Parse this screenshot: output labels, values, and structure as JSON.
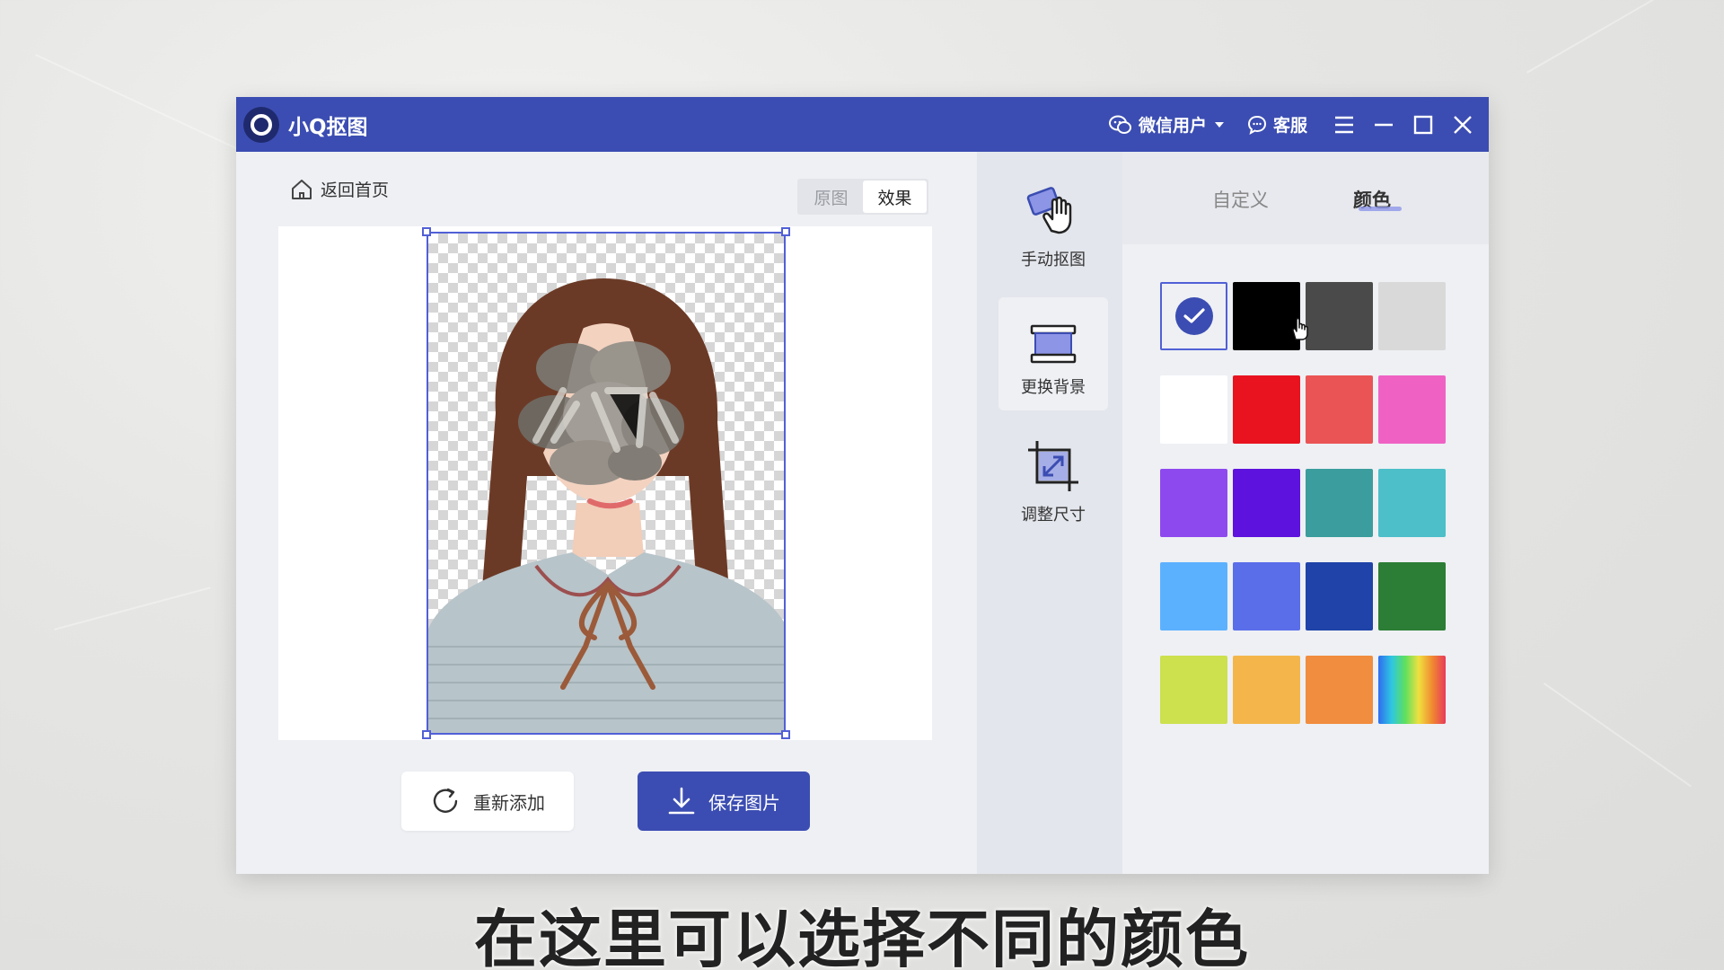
{
  "app": {
    "title": "小Q抠图"
  },
  "titlebar": {
    "user_label": "微信用户",
    "support_label": "客服"
  },
  "work": {
    "back_label": "返回首页",
    "view_toggle": {
      "original": "原图",
      "result": "效果"
    },
    "readd_label": "重新添加",
    "save_label": "保存图片"
  },
  "tools": [
    {
      "label": "手动抠图"
    },
    {
      "label": "更换背景"
    },
    {
      "label": "调整尺寸"
    }
  ],
  "panel": {
    "tabs": {
      "custom": "自定义",
      "color": "颜色"
    },
    "swatches": [
      "#eef0f4",
      "#000000",
      "#4a4a4a",
      "#d9d9d9",
      "#ffffff",
      "#e8131f",
      "#ea5454",
      "#ef62c4",
      "#8d49ee",
      "#5d12dd",
      "#3b9d9d",
      "#4cbfc9",
      "#5cb1ff",
      "#5a6ee9",
      "#1f43a8",
      "#2c7d35",
      "#cde04e",
      "#f4b64a",
      "#f18d3e",
      "rainbow"
    ],
    "selected_index": 0
  },
  "subtitle": "在这里可以选择不同的颜色"
}
